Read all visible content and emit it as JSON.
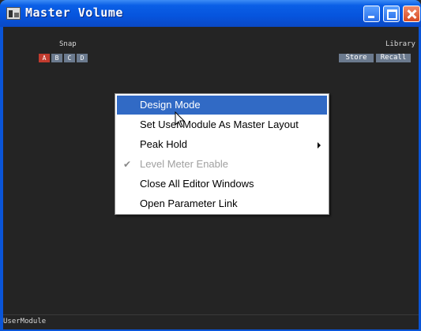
{
  "window": {
    "title": "Master Volume",
    "title_bar_color": "#0a55d8",
    "icons": [
      "app-icon",
      "minimize-icon",
      "maximize-icon",
      "close-icon"
    ]
  },
  "snap": {
    "label": "Snap",
    "buttons": [
      "A",
      "B",
      "C",
      "D"
    ],
    "active": "A",
    "active_color": "#c13b2e",
    "button_color": "#6b7a8e"
  },
  "library": {
    "label": "Library",
    "store": "Store",
    "recall": "Recall"
  },
  "context_menu": {
    "items": [
      {
        "label": "Design Mode",
        "highlighted": true
      },
      {
        "label": "Set User Module As Master Layout"
      },
      {
        "label": "Peak Hold",
        "submenu": true
      },
      {
        "label": "Level Meter Enable",
        "checked": true,
        "disabled": true
      },
      {
        "label": "Close All Editor Windows"
      },
      {
        "label": "Open Parameter Link"
      }
    ],
    "highlight_color": "#316ac5"
  },
  "status_bar": {
    "text": "UserModule"
  }
}
